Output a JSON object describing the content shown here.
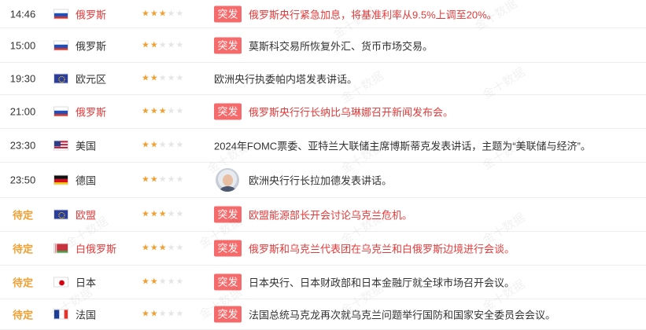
{
  "badge_label": "突发",
  "watermark": "金十数据",
  "rows": [
    {
      "time": "14:46",
      "country": "俄罗斯",
      "flag": "russia-flag",
      "stars": 3,
      "badge": true,
      "content": "俄罗斯央行紧急加息，将基准利率从9.5%上调至20%。",
      "important": true
    },
    {
      "time": "15:00",
      "country": "俄罗斯",
      "flag": "russia-flag",
      "stars": 2,
      "badge": true,
      "content": "莫斯科交易所恢复外汇、货币市场交易。",
      "important": false
    },
    {
      "time": "19:30",
      "country": "欧元区",
      "flag": "eu-flag",
      "stars": 2,
      "badge": false,
      "content": "欧洲央行执委帕内塔发表讲话。",
      "important": false
    },
    {
      "time": "21:00",
      "country": "俄罗斯",
      "flag": "russia-flag",
      "stars": 3,
      "badge": true,
      "content": "俄罗斯央行行长纳比乌琳娜召开新闻发布会。",
      "important": true
    },
    {
      "time": "23:30",
      "country": "美国",
      "flag": "usa-flag",
      "stars": 2,
      "badge": false,
      "content": "2024年FOMC票委、亚特兰大联储主席博斯蒂克发表讲话，主题为“美联储与经济”。",
      "important": false
    },
    {
      "time": "23:50",
      "country": "德国",
      "flag": "germany-flag",
      "stars": 2,
      "badge": false,
      "avatar": true,
      "content": "欧洲央行行长拉加德发表讲话。",
      "important": false
    },
    {
      "time": "待定",
      "country": "欧盟",
      "flag": "eu-flag",
      "stars": 3,
      "badge": true,
      "content": "欧盟能源部长开会讨论乌克兰危机。",
      "important": true
    },
    {
      "time": "待定",
      "country": "白俄罗斯",
      "flag": "belarus-flag",
      "stars": 3,
      "badge": true,
      "content": "俄罗斯和乌克兰代表团在乌克兰和白俄罗斯边境进行会谈。",
      "important": true
    },
    {
      "time": "待定",
      "country": "日本",
      "flag": "japan-flag",
      "stars": 2,
      "badge": true,
      "content": "日本央行、日本财政部和日本金融厅就全球市场召开会议。",
      "important": false
    },
    {
      "time": "待定",
      "country": "法国",
      "flag": "france-flag",
      "stars": 2,
      "badge": true,
      "content": "法国总统马克龙再次就乌克兰问题举行国防和国家安全委员会会议。",
      "important": false
    }
  ]
}
